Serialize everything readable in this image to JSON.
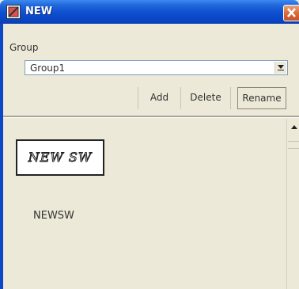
{
  "window": {
    "title": "NEW"
  },
  "group": {
    "label": "Group",
    "selected": "Group1"
  },
  "buttons": {
    "add": "Add",
    "delete": "Delete",
    "rename": "Rename"
  },
  "items": [
    {
      "graphic_label": "NEW SW",
      "name": "NEWSW"
    }
  ],
  "icons": {
    "app": "app-icon",
    "close": "close-icon",
    "dropdown": "chevron-down-icon",
    "scroll_up": "scroll-up-icon"
  },
  "colors": {
    "titlebar": "#0a44c4",
    "close": "#d96c3c",
    "background": "#ece9d8"
  }
}
